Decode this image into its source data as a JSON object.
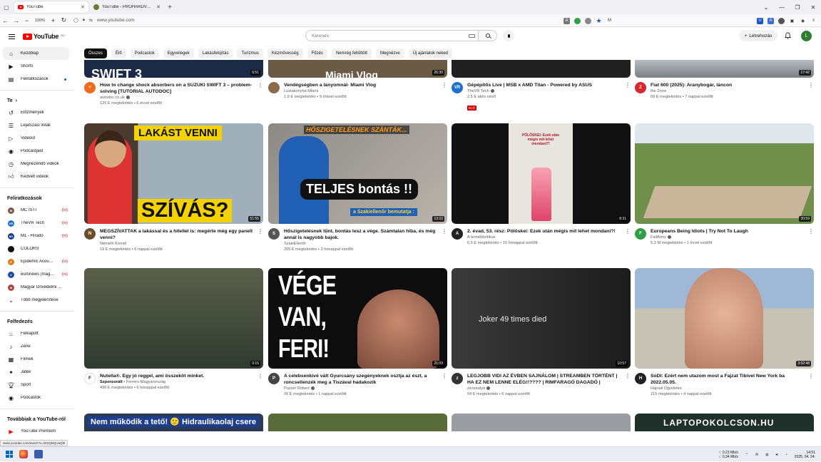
{
  "browser": {
    "tabs": [
      {
        "label": "YouTube",
        "active": true
      },
      {
        "label": "YouTube - PROHARDVER! Hozz",
        "active": false
      }
    ],
    "zoom": "100%",
    "url": "www.youtube.com",
    "status_url": "www.youtube.com/watch?v=DISQBQUaQ9I"
  },
  "header": {
    "logo_text": "YouTube",
    "country_code": "HU",
    "search_placeholder": "Keresés",
    "create_label": "Létrehozás",
    "avatar_letter": "L"
  },
  "sidebar": {
    "main": [
      {
        "label": "Kezdőlap",
        "icon": "home-icon"
      },
      {
        "label": "Shorts",
        "icon": "shorts-icon"
      },
      {
        "label": "Feliratkozások",
        "icon": "subscriptions-icon"
      }
    ],
    "you_heading": "Te",
    "you": [
      {
        "label": "Előzmények",
        "icon": "history-icon"
      },
      {
        "label": "Lejátszási listák",
        "icon": "playlist-icon"
      },
      {
        "label": "Videóid",
        "icon": "video-icon"
      },
      {
        "label": "Podcastjaid",
        "icon": "podcast-icon"
      },
      {
        "label": "Megnézendő videók",
        "icon": "clock-icon"
      },
      {
        "label": "Kedvelt videók",
        "icon": "like-icon"
      }
    ],
    "subs_heading": "Feliratkozások",
    "subs": [
      {
        "label": "MC ISTI",
        "color": "#7a5a4a",
        "initial": "M",
        "live": true
      },
      {
        "label": "TheVR Tech",
        "color": "#1e6fd0",
        "initial": "VR",
        "live": true
      },
      {
        "label": "M1 - Híradó",
        "color": "#1a3b8c",
        "initial": "M1",
        "live": true
      },
      {
        "label": "COLORS",
        "color": "#111111",
        "initial": "",
        "live": false
      },
      {
        "label": "Epidemic Acoustic",
        "color": "#e07b1b",
        "initial": "E",
        "live": true
      },
      {
        "label": "euronews (magy...",
        "color": "#1f4fa3",
        "initial": "e",
        "live": true
      },
      {
        "label": "Magyar Önvédelmi ...",
        "color": "#b0413e",
        "initial": "M",
        "live": false
      }
    ],
    "more_label": "Több megjelenítése",
    "explore_heading": "Felfedezés",
    "explore": [
      {
        "label": "Felkapott",
        "icon": "trending-icon"
      },
      {
        "label": "Zene",
        "icon": "music-icon"
      },
      {
        "label": "Filmek",
        "icon": "film-icon"
      },
      {
        "label": "Játék",
        "icon": "gaming-icon"
      },
      {
        "label": "Sport",
        "icon": "trophy-icon"
      },
      {
        "label": "Podcastok",
        "icon": "podcast-icon"
      }
    ],
    "more_yt_heading": "Továbbiak a YouTube-ról",
    "more_yt": [
      {
        "label": "YouTube Premium",
        "icon": "yt-premium-icon"
      },
      {
        "label": "YouTube Studio",
        "icon": "yt-studio-icon"
      }
    ]
  },
  "chips": [
    "Összes",
    "Élő",
    "Podcastok",
    "Egyvelegek",
    "Lakásfelújítás",
    "Turizmus",
    "Kézművesség",
    "Főzés",
    "Nemrég feltöltött",
    "Megnézve",
    "Új ajánlatok neked"
  ],
  "row0": [
    {
      "title": "How to change shock absorbers on a SUZUKI SWIFT 3 – problem-solving [TUTORIAL AUTODOC]",
      "channel": "autodoc.co.uk",
      "verified": true,
      "stats": "125 E megtekintés • 6 évvel ezelőtt",
      "duration": "6:51",
      "av_color": "#f26b1d",
      "av_text": "+",
      "thumb_text": "SWIFT 3",
      "thumb_bg": "#1b2a45"
    },
    {
      "title": "Vendégségben a lányomnál- Miami Vlog",
      "channel": "Lustakonyha Miami",
      "verified": false,
      "stats": "1,9 E megtekintés • 9 órával ezelőtt",
      "duration": "26:30",
      "av_color": "#8b6b4a",
      "av_text": "",
      "thumb_text": "Miami Vlog",
      "thumb_bg": "#6b5a45"
    },
    {
      "title": "Gépépítős Live | MSB x AMD Titan - Powered by ASUS",
      "channel": "TheVR Tech",
      "verified": true,
      "stats": "2,5 E aktív néző",
      "live_badge": "ÉLŐ",
      "duration": "",
      "av_color": "#1e6fd0",
      "av_text": "VR",
      "thumb_text": "",
      "thumb_bg": "#202020"
    },
    {
      "title": "Fiat 600 (2025): Aranybogár, láncon",
      "channel": "the Zone",
      "verified": false,
      "stats": "69 E megtekintés • 7 nappal ezelőtt",
      "duration": "17:42",
      "av_color": "#d8262d",
      "av_text": "Z",
      "thumb_text": "",
      "thumb_bg": "#8a8f95"
    }
  ],
  "row1": [
    {
      "title": "MEGSZÍVATTAK a lakással és a hitellel is: megérte még egy panelt venni?",
      "channel": "Németh Kornél",
      "verified": false,
      "stats": "19 E megtekintés • 6 nappal ezelőtt",
      "duration": "51:55",
      "av_color": "#6b4f2c",
      "av_text": "N",
      "thumb_text": "LAKÁST VENNI",
      "thumb_text2": "SZÍVÁS?",
      "thumb_bg": "#9aa7b0"
    },
    {
      "title": "Hőszigetelésnek tűnt, bontás lesz a vége. Számtalan hiba, és még annál is nagyobb bajok.",
      "channel": "SzakiEllenőr",
      "verified": false,
      "stats": "205 E megtekintés • 3 hónappal ezelőtt",
      "duration": "13:22",
      "av_color": "#555555",
      "av_text": "S",
      "thumb_text": "HŐSZIGETELÉSNEK SZÁNTÁK...",
      "thumb_text2": "TELJES bontás !!",
      "thumb_text3": "a Szakiellenőr bemutatja :",
      "thumb_bg": "#8d8a86"
    },
    {
      "title": "2. évad, 53. rész: Pölöskei: Ezek után mégis mit lehet mondani?!",
      "channel": "A termékkritikus",
      "verified": false,
      "stats": "6,9 E megtekintés • 10 hónappal ezelőtt",
      "duration": "8:31",
      "av_color": "#222222",
      "av_text": "A",
      "thumb_text": "PÖLÖSKEI: Ezek után mégis mit lehet mondani?!",
      "thumb_bg": "#111111"
    },
    {
      "title": "Europeans Being Idiots | Try Not To Laugh",
      "channel": "FailArmy",
      "verified": true,
      "stats": "5,3 M megtekintés • 1 évvel ezelőtt",
      "duration": "30:59",
      "av_color": "#2f9e44",
      "av_text": "F",
      "thumb_text": "",
      "thumb_bg": "#6f8f4a"
    }
  ],
  "row2": [
    {
      "title": "Nutella®. Egy jó reggel, ami összeköt minket.",
      "channel_sponsor": "Szponzorált",
      "channel": "Ferrero Magyarország",
      "verified": false,
      "stats": "496 E megtekintés • 6 hónappal ezelőtt",
      "duration": "0:15",
      "av_color": "#ffffff",
      "av_text": "F",
      "thumb_text": "",
      "thumb_bg": "#3f4a3a"
    },
    {
      "title": "A celebsenkivé vált Gyurcsány szegényeknek osztja az észt, a roncsellenzék meg a Tiszával hadakozik",
      "channel": "Puzsér Róbert",
      "verified": true,
      "stats": "26 E megtekintés • 1 nappal ezelőtt",
      "duration": "21:09",
      "av_color": "#444444",
      "av_text": "P",
      "thumb_text": "VÉGE",
      "thumb_text2": "VAN,",
      "thumb_text3": "FERI!",
      "thumb_bg": "#0d0d0d"
    },
    {
      "title": "LEGJOBB VIDI AZ ÉVBEN SAJNÁLOM | STREAMBEN TÖRTÉNT | HA EZ NEM LENNE ELÉG!!???? | RIMFARAGÓ DAGADÓ |",
      "channel": "zsozeatya",
      "verified": true,
      "stats": "94 E megtekintés • 6 nappal ezelőtt",
      "duration": "10:57",
      "av_color": "#333333",
      "av_text": "z",
      "thumb_text": "Joker 49 times died",
      "thumb_bg": "#2a2a2a"
    },
    {
      "title": "SoDI: Ezért nem utazom most a Fajzat Tibivel New York ba 2022.05.05.",
      "channel": "Hajnali Ügyeletes",
      "verified": false,
      "stats": "215 megtekintés • 4 nappal ezelőtt",
      "duration": "3:02:48",
      "av_color": "#222222",
      "av_text": "H",
      "thumb_text": "",
      "thumb_bg": "#8aa6c8"
    }
  ],
  "row3": [
    {
      "thumb_text": "Nem működik a tető! 🙁 Hidraulikaolaj csere",
      "thumb_bg": "#2b3a55"
    },
    {
      "thumb_text": "",
      "thumb_bg": "#5a6b3a"
    },
    {
      "thumb_text": "",
      "thumb_bg": "#9a9ea3"
    },
    {
      "thumb_text": "LAPTOPOKOLCSON.HU",
      "thumb_bg": "#1f2f2a"
    }
  ],
  "taskbar": {
    "net_up": "↑: 0.23 Mb/s",
    "net_down": "↓: 0.34 Mb/s",
    "time": "14:51",
    "date": "2025. 04. 24."
  }
}
